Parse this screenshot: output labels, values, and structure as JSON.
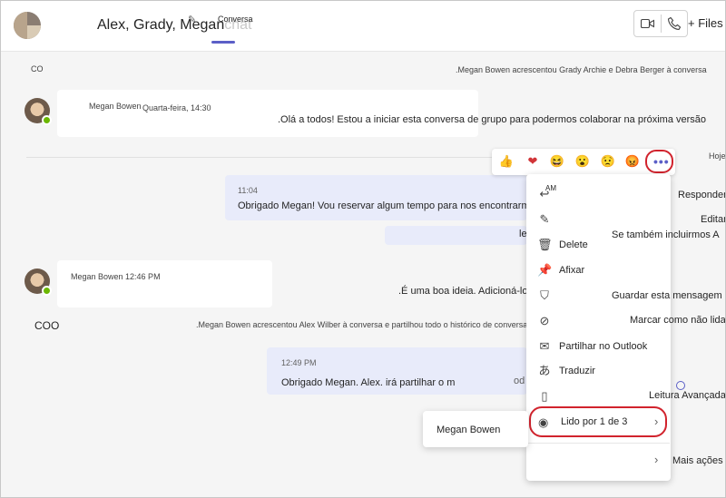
{
  "header": {
    "title": "Alex, Grady, Megan",
    "title_faded": "chat",
    "tab_conversa": "Conversa",
    "files_tab": "+ Files",
    "icons": [
      "video-icon",
      "phone-icon",
      "pencil-icon"
    ]
  },
  "system": {
    "co_badge": "CO",
    "added_grady": ".Megan Bowen acrescentou Grady Archie e Debra Berger à conversa",
    "added_alex": ".Megan Bowen acrescentou Alex Wilber à conversa e partilhou todo o histórico de conversas",
    "coo": "COO",
    "today": "Hoje"
  },
  "messages": [
    {
      "sender": "Megan Bowen",
      "time": "Quarta-feira, 14:30",
      "text": ".Olá a todos! Estou a iniciar esta conversa de grupo para podermos colaborar na próxima versão"
    },
    {
      "time": "11:04",
      "text": "Obrigado Megan! Vou reservar algum tempo para nos encontrarmos."
    },
    {
      "text": "le"
    },
    {
      "sender": "Megan Bowen 12:46 PM",
      "text": ".É uma boa ideia. Adicioná-lo agora"
    },
    {
      "time": "12:49 PM",
      "text": "Obrigado Megan. Alex. irá partilhar o m",
      "tail": "od"
    }
  ],
  "reactions": [
    "👍",
    "❤",
    "😆",
    "😮",
    "😟",
    "😡"
  ],
  "more_button": "•••",
  "context_menu": {
    "am": "AM",
    "items": [
      {
        "icon": "reply-icon",
        "label": ""
      },
      {
        "icon": "edit-icon",
        "label": ""
      },
      {
        "icon": "delete-icon",
        "label": "Delete"
      },
      {
        "icon": "pin-icon",
        "label": "Afixar"
      },
      {
        "icon": "bookmark-icon",
        "label": ""
      },
      {
        "icon": "unread-icon",
        "label": ""
      },
      {
        "icon": "mail-icon",
        "label": "Partilhar no Outlook"
      },
      {
        "icon": "translate-icon",
        "label": "Traduzir"
      },
      {
        "icon": "immersive-reader-icon",
        "label": ""
      }
    ],
    "read_by": "Lido por 1 de 3",
    "read_by_submenu": "Megan Bowen"
  },
  "right_labels": {
    "responder": "Responder",
    "editar": "Editar",
    "se_tambem": "Se também incluirmos A",
    "guardar": "Guardar esta mensagem",
    "marcar": "Marcar como não lida",
    "leitura": "Leitura Avançada",
    "mais_acoes": "Mais ações"
  }
}
